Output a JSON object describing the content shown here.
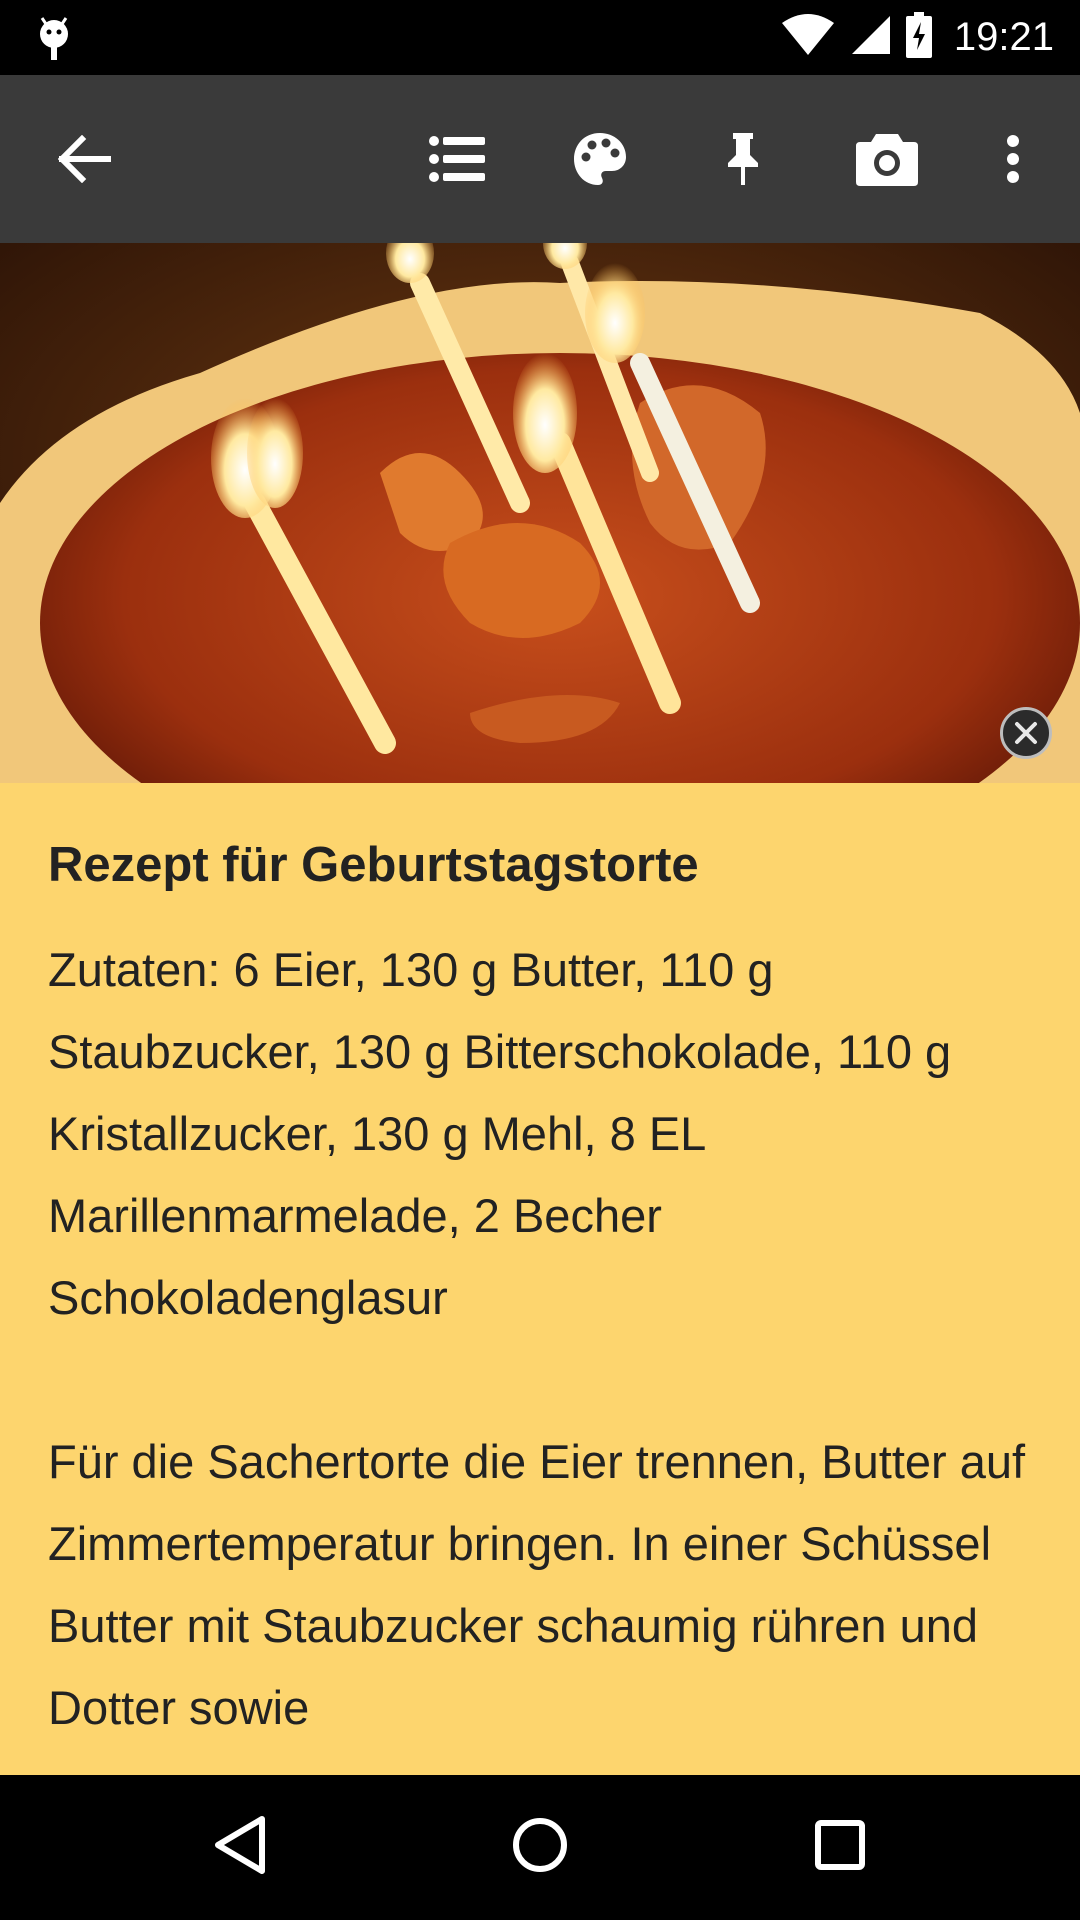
{
  "status_bar": {
    "time": "19:21",
    "icons": [
      "android-debug-icon",
      "wifi-icon",
      "cell-signal-icon",
      "battery-charging-icon"
    ]
  },
  "toolbar": {
    "icons": [
      "back-arrow-icon",
      "checklist-icon",
      "palette-icon",
      "pin-icon",
      "camera-icon",
      "more-vert-icon"
    ]
  },
  "note": {
    "title": "Rezept für Geburtstagstorte",
    "body": "Zutaten: 6 Eier, 130 g Butter, 110 g Staubzucker, 130 g Bitterschokolade, 110 g Kristallzucker, 130 g Mehl, 8 EL Marillenmarmelade, 2 Becher Schokoladenglasur\n\nFür die Sachertorte die Eier trennen, Butter auf Zimmertemperatur bringen. In einer Schüssel Butter mit Staubzucker schaumig rühren und Dotter sowie",
    "background_color": "#FDD56E"
  },
  "navigation": {
    "icons": [
      "back-triangle-icon",
      "home-circle-icon",
      "recents-square-icon"
    ]
  },
  "colors": {
    "toolbar": "#3A3A3A",
    "note_background": "#FDD56E",
    "text": "#222222"
  }
}
